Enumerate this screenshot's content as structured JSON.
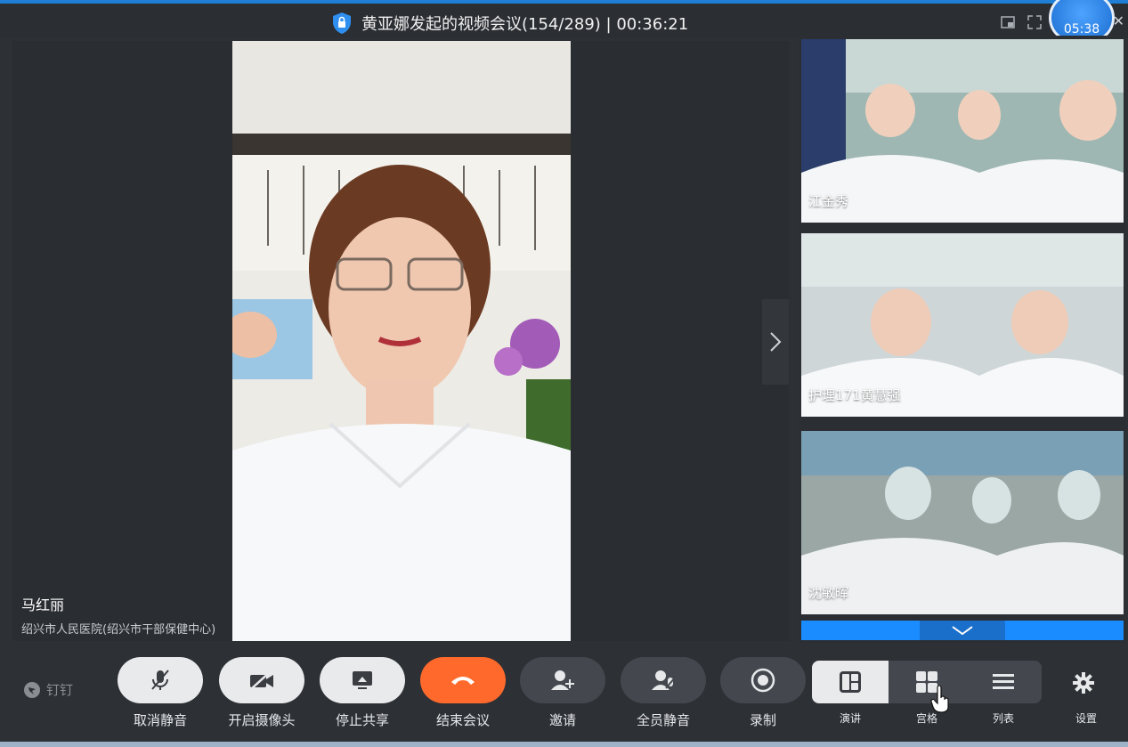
{
  "window": {
    "title": "黄亚娜发起的视频会议(154/289) | 00:36:21",
    "timer_bubble": "05:38"
  },
  "main_speaker": {
    "name": "马红丽",
    "org": "绍兴市人民医院(绍兴市干部保健中心)"
  },
  "participants": [
    {
      "name": "江金秀"
    },
    {
      "name": "护理171黄慧强"
    },
    {
      "name": "沈敏晖"
    }
  ],
  "toolbar": {
    "brand": "钉钉",
    "unmute": "取消静音",
    "camera_on": "开启摄像头",
    "stop_share": "停止共享",
    "end_meeting": "结束会议",
    "invite": "邀请",
    "mute_all": "全员静音",
    "record": "录制",
    "layout_speaker": "演讲",
    "layout_grid": "宫格",
    "layout_list": "列表",
    "settings": "设置"
  },
  "colors": {
    "accent": "#1b8cff",
    "end_button": "#ff6a2c",
    "background": "#2d3035"
  }
}
